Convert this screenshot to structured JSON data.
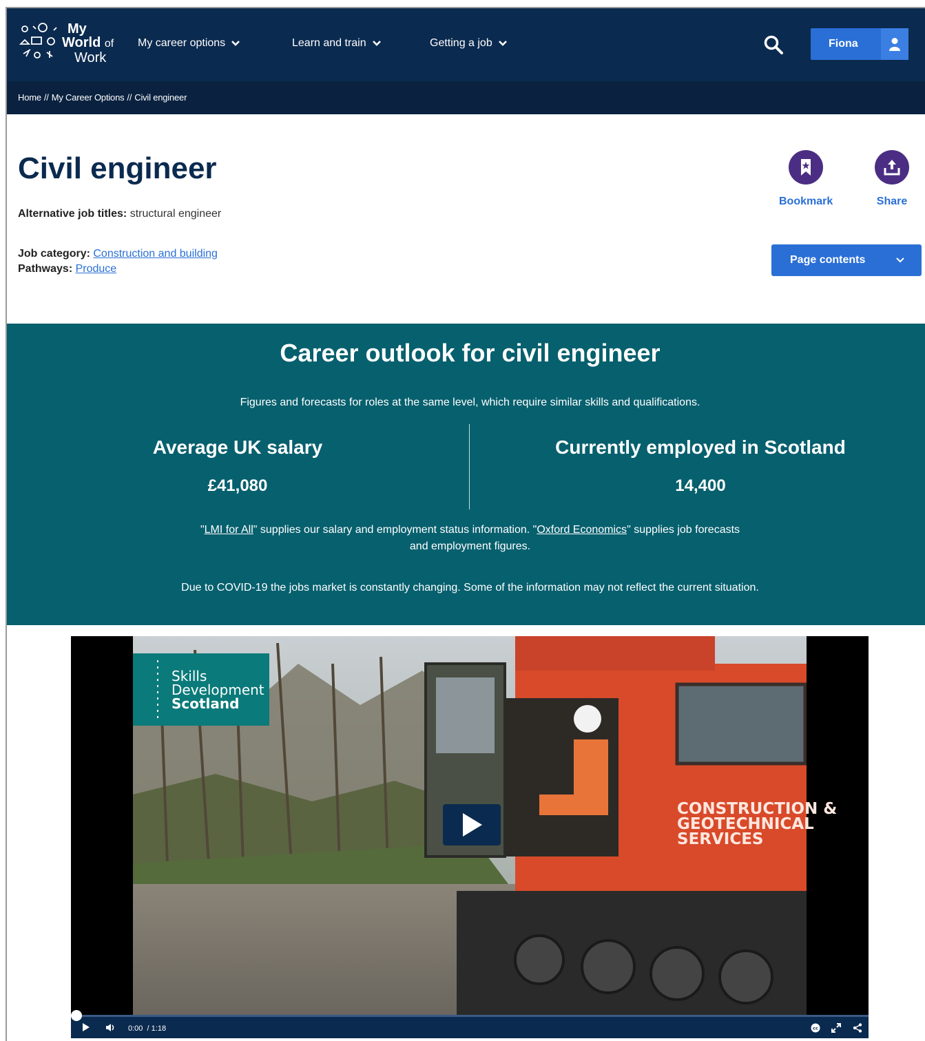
{
  "header": {
    "logo": {
      "line1": "My",
      "line2": "World",
      "line2_suffix": "of",
      "line3": "Work"
    },
    "nav": [
      {
        "label": "My career options"
      },
      {
        "label": "Learn and train"
      },
      {
        "label": "Getting a job"
      }
    ],
    "user_label": "Fiona"
  },
  "breadcrumb": {
    "items": [
      "Home",
      "My Career Options",
      "Civil engineer"
    ],
    "separator": "//"
  },
  "job": {
    "title": "Civil engineer",
    "alt_titles_label": "Alternative job titles:",
    "alt_titles_value": "structural engineer",
    "category_label": "Job category:",
    "category_value": "Construction and building",
    "pathways_label": "Pathways:",
    "pathways_value": "Produce"
  },
  "actions": {
    "bookmark": "Bookmark",
    "share": "Share",
    "page_contents": "Page contents"
  },
  "outlook": {
    "title": "Career outlook for civil engineer",
    "intro": "Figures and forecasts for roles at the same level, which require similar skills and qualifications.",
    "salary_label": "Average UK salary",
    "salary_value": "£41,080",
    "employed_label": "Currently employed in Scotland",
    "employed_value": "14,400",
    "source_lmi": "LMI for All",
    "source_mid": "\" supplies our salary and employment status information. \"",
    "source_oxford": "Oxford Economics",
    "source_end": "\" supplies job forecasts and employment figures.",
    "covid": "Due to COVID-19 the jobs market is constantly changing. Some of the information may not reflect the current situation."
  },
  "video": {
    "brand_line1": "Skills",
    "brand_line2": "Development",
    "brand_line3": "Scotland",
    "vehicle_text_1": "CONSTRUCTION &",
    "vehicle_text_2": "GEOTECHNICAL",
    "vehicle_text_3": "SERVICES",
    "time_current": "0:00",
    "time_total": "/ 1:18",
    "progress": 0
  },
  "colors": {
    "header": "#0b2a4f",
    "accent_blue": "#2a6fd6",
    "purple": "#4b2e83",
    "teal": "#07606e"
  }
}
